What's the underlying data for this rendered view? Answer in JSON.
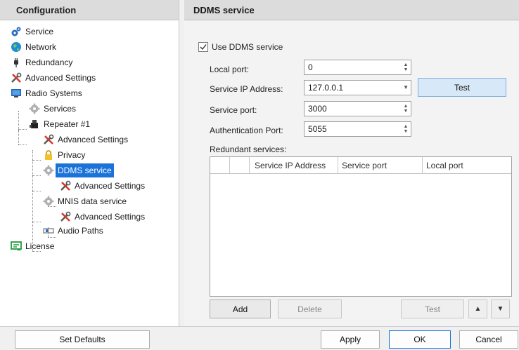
{
  "left_panel": {
    "title": "Configuration"
  },
  "tree": {
    "service": "Service",
    "network": "Network",
    "redundancy": "Redundancy",
    "advanced_settings": "Advanced Settings",
    "radio_systems": "Radio Systems",
    "services": "Services",
    "repeater": "Repeater #1",
    "repeater_advanced": "Advanced Settings",
    "privacy": "Privacy",
    "ddms_service": "DDMS service",
    "ddms_advanced": "Advanced Settings",
    "mnis_service": "MNIS data service",
    "mnis_advanced": "Advanced Settings",
    "audio_paths": "Audio Paths",
    "license": "License"
  },
  "right_panel": {
    "title": "DDMS service",
    "use_ddms_label": "Use DDMS service",
    "use_ddms_checked": true,
    "local_port_label": "Local port:",
    "local_port_value": "0",
    "service_ip_label": "Service IP Address:",
    "service_ip_value": "127.0.0.1",
    "test_label": "Test",
    "service_port_label": "Service port:",
    "service_port_value": "3000",
    "auth_port_label": "Authentication Port:",
    "auth_port_value": "5055",
    "redundant_label": "Redundant services:",
    "columns": [
      "Service IP Address",
      "Service port",
      "Local port"
    ],
    "add_label": "Add",
    "delete_label": "Delete",
    "grid_test_label": "Test",
    "up_label": "▲",
    "down_label": "▼"
  },
  "footer": {
    "set_defaults": "Set Defaults",
    "apply": "Apply",
    "ok": "OK",
    "cancel": "Cancel"
  },
  "colors": {
    "selection": "#1a73d9",
    "test_button": "#d7e8f8"
  }
}
